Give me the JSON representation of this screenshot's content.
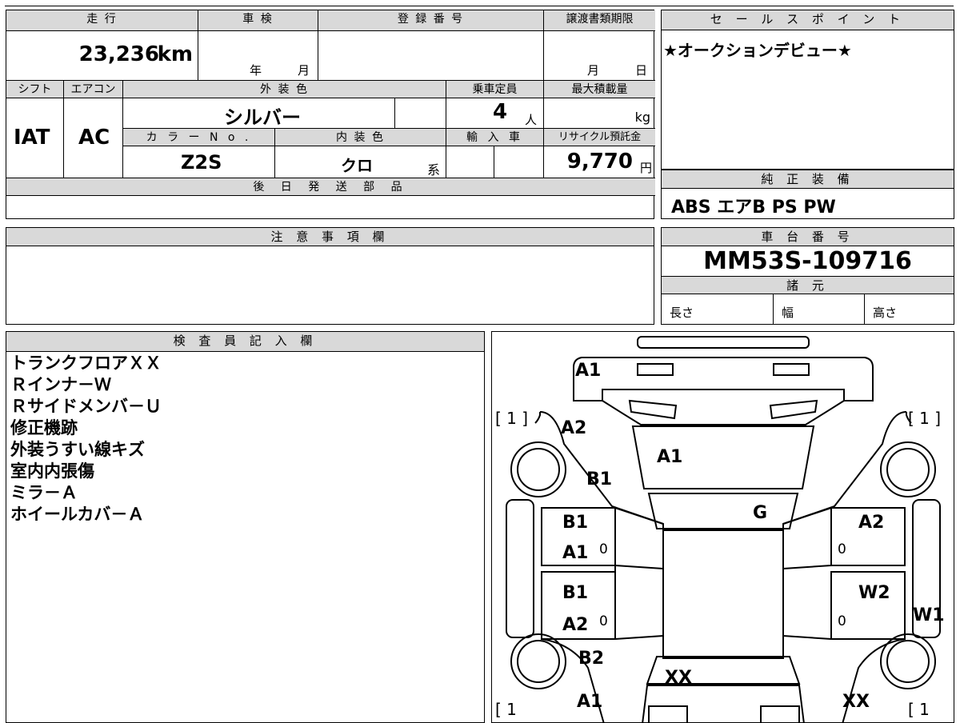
{
  "sheet": {
    "mileage": {
      "label": "走 行",
      "value": "23,236",
      "unit": "km"
    },
    "inspection": {
      "label": "車 検",
      "year": "年",
      "month": "月"
    },
    "registration": {
      "label": "登 録 番 号",
      "value": ""
    },
    "transfer_deadline": {
      "label": "譲渡書類期限",
      "month": "月",
      "day": "日"
    },
    "sales_point": {
      "label": "セ ー ル ス ポ イ ン ト",
      "text": "★オークションデビュー★"
    },
    "shift": {
      "label": "シフト",
      "value": "IAT"
    },
    "aircon": {
      "label": "エアコン",
      "value": "AC"
    },
    "exterior_color": {
      "label": "外 装 色",
      "value": "シルバー"
    },
    "capacity": {
      "label": "乗車定員",
      "value": "4",
      "unit": "人"
    },
    "max_load": {
      "label": "最大積載量",
      "unit": "kg"
    },
    "color_no": {
      "label": "カ ラ ー N o .",
      "value": "Z2S"
    },
    "interior_color": {
      "label": "内 装 色",
      "value": "クロ",
      "suffix": "系"
    },
    "import": {
      "label": "輸 入 車"
    },
    "recycle": {
      "label": "リサイクル預託金",
      "value": "9,770",
      "unit": "円"
    },
    "later_parts": {
      "label": "後 日 発 送 部 品"
    },
    "genuine_equipment": {
      "label": "純 正 装 備",
      "value": "ABS エアB PS PW"
    },
    "notes": {
      "label": "注 意 事 項 欄"
    },
    "chassis_no": {
      "label": "車 台 番 号",
      "value": "MM53S-109716"
    },
    "specs": {
      "label": "諸 元",
      "length": "長さ",
      "width": "幅",
      "height": "高さ"
    },
    "inspector": {
      "label": "検 査 員 記 入 欄",
      "lines": [
        "トランクフロアＸＸ",
        "Ｒインナ－Ｗ",
        "Ｒサイドメンバ－Ｕ",
        "修正機跡",
        "外装うすい線キズ",
        "室内内張傷",
        "ミラ－Ａ",
        "ホイールカバ－Ａ"
      ]
    }
  },
  "diagram": {
    "codes": {
      "rear_bumper": "A1",
      "rear_left_quarter": "A2",
      "rear_left_door_lower": "B1",
      "trunk_lid": "A1",
      "rear_glass": "G",
      "left_rear_door_1": "B1",
      "left_rear_door_2": "A1",
      "left_front_door_1": "B1",
      "left_front_door_2": "A2",
      "right_rear_door": "A2",
      "right_front_door": "W2",
      "right_sill": "W1",
      "left_fender": "B2",
      "hood": "XX",
      "front_bumper_left": "A1",
      "front_bumper_right": "XX"
    },
    "brackets": {
      "top_left": "[ 1 ]",
      "top_right": "[ 1 ]",
      "bottom_left": "[ 1",
      "bottom_right": "[ 1"
    },
    "zeros": [
      "0",
      "0",
      "0",
      "0"
    ]
  }
}
